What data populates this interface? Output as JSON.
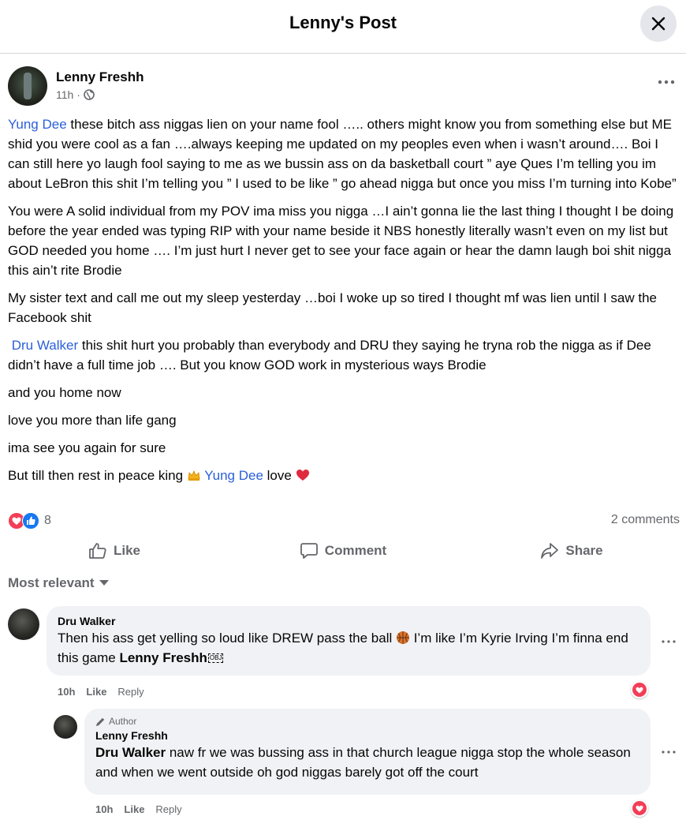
{
  "header": {
    "title": "Lenny's Post"
  },
  "post": {
    "author": "Lenny Freshh",
    "time": "11h ·",
    "paragraphs": {
      "p1_mention": "Yung Dee",
      "p1_text": " these bitch ass niggas lien on your name fool ….. others might know you from something else but ME shid you were cool as a fan ….always keeping me updated on my peoples even when i wasn’t around…. Boi I can still here yo laugh fool saying to me as we bussin ass on da basketball court ” aye Ques I’m telling you im about LeBron this shit I’m telling you ”  I used to be like ” go ahead nigga but once you miss I’m turning into Kobe”",
      "p2": "You were A solid individual from my POV ima miss you nigga …I ain’t gonna lie the last thing I thought I be doing before the year ended was typing RIP with your name beside it NBS honestly literally wasn’t even on my list but GOD needed you home …. I’m just hurt I never get to see your face again or hear the damn laugh boi shit nigga this ain’t rite Brodie",
      "p3": "My sister text and call me out my sleep yesterday …boi I woke up so tired I thought mf was lien until I saw the Facebook shit",
      "p4_mention": "Dru Walker",
      "p4_text": " this shit hurt you probably than everybody and DRU they saying he tryna rob the nigga as if Dee didn’t have a full time job …. But you know GOD work in mysterious ways Brodie",
      "p5": "and you home now",
      "p6": "love you more than life gang",
      "p7": " ima see you again for sure",
      "p8_pre": " But till then rest in peace king ",
      "p8_mention": "Yung Dee",
      "p8_post": " love "
    },
    "reaction_count": "8",
    "comment_count": "2 comments"
  },
  "actions": {
    "like": "Like",
    "comment": "Comment",
    "share": "Share"
  },
  "sort_label": "Most relevant",
  "comments": [
    {
      "name": "Dru Walker",
      "text_pre": "Then his ass get yelling so loud like DREW pass the ball ",
      "text_mid": " I’m like I’m Kyrie Irving I’m finna end this game ",
      "text_mention": "Lenny Freshh",
      "obj": "OBJ",
      "time": "10h",
      "like": "Like",
      "reply": "Reply"
    },
    {
      "author_tag": "Author",
      "name": "Lenny Freshh",
      "text_mention": "Dru Walker",
      "text": " naw fr we was bussing ass in that church league nigga stop the whole season and when we went outside oh god niggas barely got off the court",
      "time": "10h",
      "like": "Like",
      "reply": "Reply"
    }
  ],
  "colors": {
    "mention": "#2b5fd9",
    "love": "#f33e58",
    "like": "#1877f2",
    "muted": "#65676b"
  },
  "icons": [
    "close-icon",
    "globe-icon",
    "more-icon",
    "like-icon",
    "comment-icon",
    "share-icon",
    "chevron-down-icon",
    "crown-emoji",
    "heart-emoji",
    "basketball-emoji",
    "pencil-icon"
  ]
}
